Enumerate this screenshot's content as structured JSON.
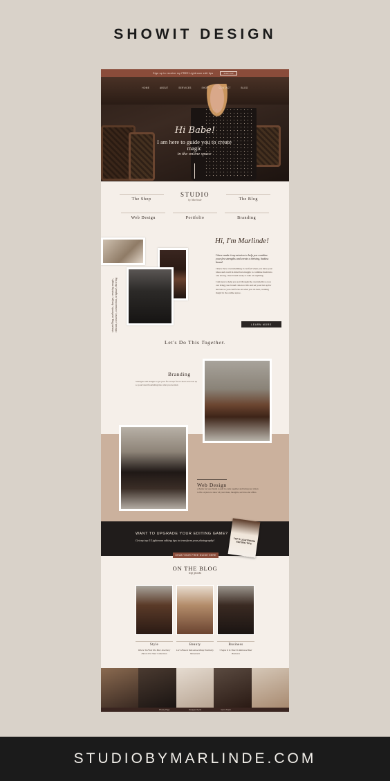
{
  "header": {
    "title": "SHOWIT DESIGN"
  },
  "footer_banner": {
    "url_text": "STUDIOBYMARLINDE.COM"
  },
  "site": {
    "topbar": {
      "text": "Sign up to receive my FREE Lightroom edit tips",
      "button": "SIGN UP"
    },
    "nav": [
      "HOME",
      "ABOUT",
      "SERVICES",
      "SHOP",
      "CONTACT",
      "BLOG"
    ],
    "hero": {
      "script": "Hi Babe!",
      "headline": "I am here to guide you to create magic",
      "script2": "in the online space"
    },
    "logo": {
      "line1": "STUDIO",
      "line2": "by Marlinde"
    },
    "menu": {
      "row1": [
        "The Shop",
        "The Blog"
      ],
      "row2": [
        "Web Design",
        "Portfolio",
        "Branding"
      ]
    },
    "about": {
      "greeting": "Hi, I'm Marlinde!",
      "intro": "I have made it my mission to help you combine your fav strengths and create a thriving, badass brand.",
      "p1": "I know how overwhelming it can feel when you have your ideas and could in mind but struggle to combine them into one strong, clear brand ready to take on anything.",
      "p2": "I am here to help you sort through the overwhelm so you can bring your brand vision to life and set your biz up for success so you can focus on what you do best, creating magic in the online space.",
      "vertical": "storytelling, authentic, design, creating magic, vibrant, creative, connection, original, thriving",
      "button": "LEARN MORE"
    },
    "services": {
      "heading_a": "Let's Do This",
      "heading_b": "Together.",
      "branding": {
        "title": "Branding",
        "text": "Strategies and designs to get your fav except for it's most loved set up so your brand flourishing into what you decided."
      },
      "web": {
        "title": "Web Design",
        "text": "A home for your brand to pull in come together and bring your vision to life. A place to show all your ideas, thoughts, services and offers."
      }
    },
    "cta": {
      "heading": "WANT TO UPGRADE YOUR EDITING GAME?",
      "text": "Get my top 5 Lightroom editing tips to transform your photography!",
      "button": "GRAB YOUR FREE GUIDE HERE",
      "guide": "TOP 5 LIGHTROOM EDITING TIPS"
    },
    "blog": {
      "heading": "ON THE BLOG",
      "sub": "top posts",
      "posts": [
        {
          "cat": "Style",
          "title": "Where To Find The Best Jewellery Pieces For Your Collection"
        },
        {
          "cat": "Beauty",
          "title": "Let's Honest Talk About Body Positivity Movement"
        },
        {
          "cat": "Business",
          "title": "5 Signs It Is Time To Rebrand Your Business"
        }
      ]
    },
    "footer": [
      "Privacy Page",
      "Designed by M.",
      "Get in Touch"
    ]
  }
}
